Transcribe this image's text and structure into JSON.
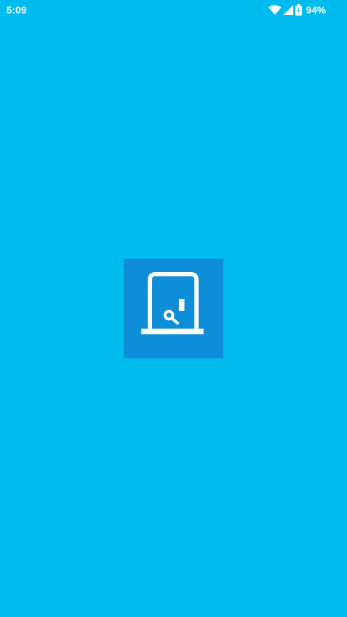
{
  "status_bar": {
    "time": "5:09",
    "battery_percent": "94%",
    "icons": [
      "wifi-icon",
      "cell-signal-icon",
      "battery-charging-icon"
    ]
  },
  "splash": {
    "logo_icon": "door-key-icon",
    "background_color": "#00BBEE",
    "logo_tile_color": "#0E8ED9"
  }
}
